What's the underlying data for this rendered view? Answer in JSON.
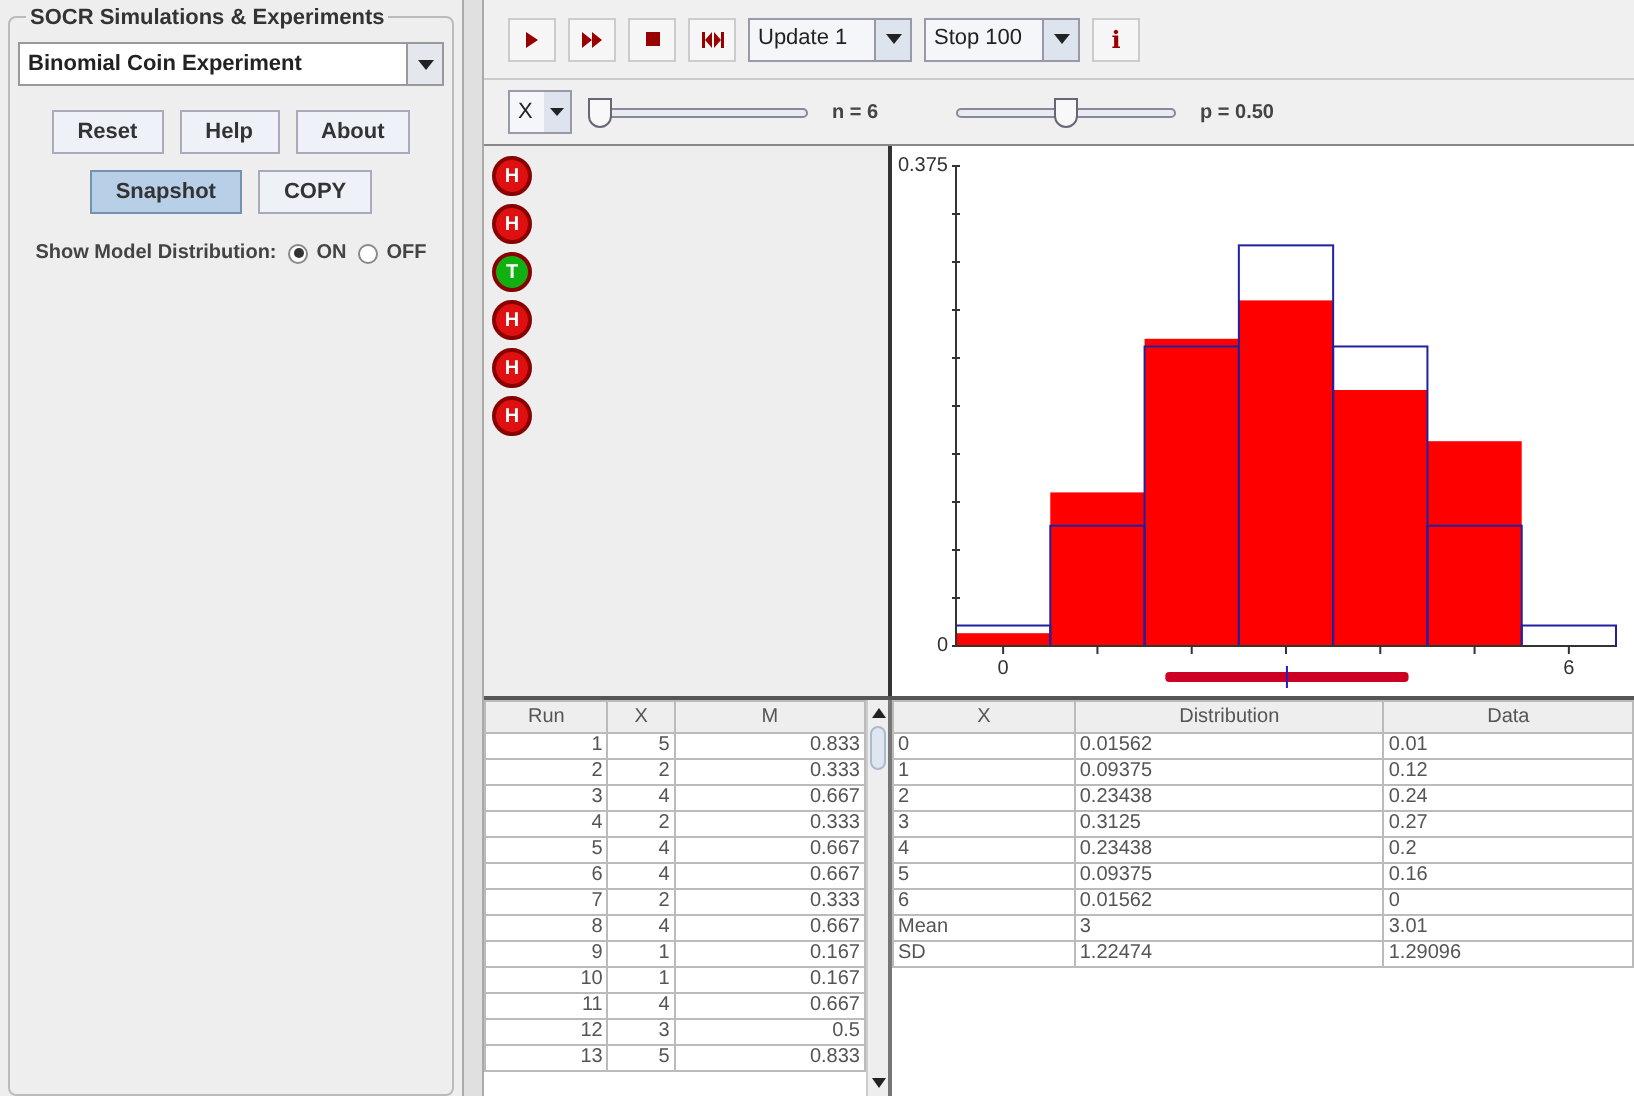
{
  "sidebar": {
    "group_title": "SOCR Simulations & Experiments",
    "experiment": "Binomial Coin Experiment",
    "buttons": [
      {
        "label": "Reset",
        "selected": false
      },
      {
        "label": "Help",
        "selected": false
      },
      {
        "label": "About",
        "selected": false
      }
    ],
    "buttons_row2": [
      {
        "label": "Snapshot",
        "selected": true
      },
      {
        "label": "COPY",
        "selected": false
      }
    ],
    "model_label": "Show Model Distribution:",
    "model_options": [
      {
        "label": "ON",
        "selected": true
      },
      {
        "label": "OFF",
        "selected": false
      }
    ]
  },
  "toolbar": {
    "update": "Update 1",
    "stop": "Stop 100",
    "info": "i"
  },
  "controls": {
    "variable": "X",
    "sliders": [
      {
        "level": 0.0,
        "reading": "n = 6"
      },
      {
        "level": 0.5,
        "reading": "p = 0.50"
      }
    ]
  },
  "coins": [
    {
      "label": "H",
      "color": "#e01010"
    },
    {
      "label": "H",
      "color": "#e01010"
    },
    {
      "label": "T",
      "color": "#10b010"
    },
    {
      "label": "H",
      "color": "#e01010"
    },
    {
      "label": "H",
      "color": "#e01010"
    },
    {
      "label": "H",
      "color": "#e01010"
    }
  ],
  "chart": {
    "chart_data": {
      "type": "bar",
      "x": [
        0,
        1,
        2,
        3,
        4,
        5,
        6
      ],
      "series": [
        {
          "color": "#2020a0",
          "values": [
            0.016,
            0.094,
            0.234,
            0.313,
            0.234,
            0.094,
            0.016
          ]
        },
        {
          "color": "#ff0000",
          "values": [
            0.01,
            0.12,
            0.24,
            0.27,
            0.2,
            0.16,
            0
          ]
        }
      ],
      "xlim": [
        -0.5,
        6.5
      ],
      "ylim": [
        0,
        0.375
      ],
      "xticks": [
        0,
        6
      ],
      "yticks": [
        0,
        0.375
      ]
    }
  },
  "runs_table": {
    "columns": [
      "Run",
      "X",
      "M"
    ],
    "rows": [
      [
        "1",
        "5",
        "0.833"
      ],
      [
        "2",
        "2",
        "0.333"
      ],
      [
        "3",
        "4",
        "0.667"
      ],
      [
        "4",
        "2",
        "0.333"
      ],
      [
        "5",
        "4",
        "0.667"
      ],
      [
        "6",
        "4",
        "0.667"
      ],
      [
        "7",
        "2",
        "0.333"
      ],
      [
        "8",
        "4",
        "0.667"
      ],
      [
        "9",
        "1",
        "0.167"
      ],
      [
        "10",
        "1",
        "0.167"
      ],
      [
        "11",
        "4",
        "0.667"
      ],
      [
        "12",
        "3",
        "0.5"
      ],
      [
        "13",
        "5",
        "0.833"
      ]
    ]
  },
  "dist_table": {
    "columns": [
      "X",
      "Distribution",
      "Data"
    ],
    "rows": [
      [
        "0",
        "0.01562",
        "0.01"
      ],
      [
        "1",
        "0.09375",
        "0.12"
      ],
      [
        "2",
        "0.23438",
        "0.24"
      ],
      [
        "3",
        "0.3125",
        "0.27"
      ],
      [
        "4",
        "0.23438",
        "0.2"
      ],
      [
        "5",
        "0.09375",
        "0.16"
      ],
      [
        "6",
        "0.01562",
        "0"
      ],
      [
        "Mean",
        "3",
        "3.01"
      ],
      [
        "SD",
        "1.22474",
        "1.29096"
      ]
    ]
  }
}
